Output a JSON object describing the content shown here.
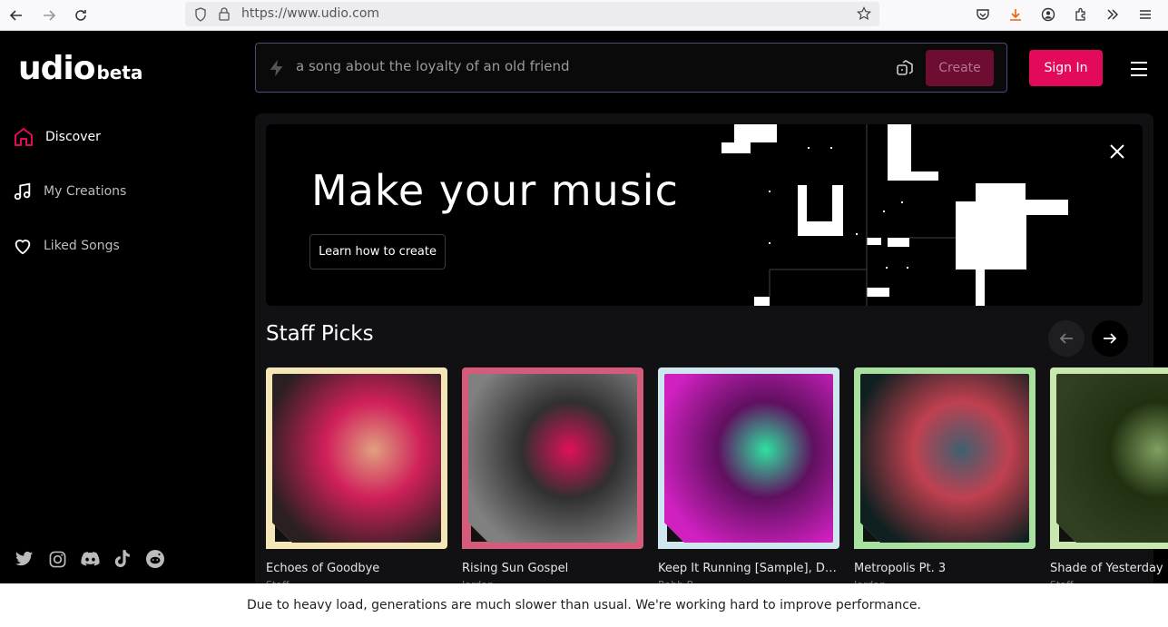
{
  "browser": {
    "url": "https://www.udio.com"
  },
  "logo": {
    "main": "udio",
    "beta": "beta"
  },
  "sidebar": {
    "items": [
      {
        "label": "Discover",
        "icon": "home-icon",
        "active": true
      },
      {
        "label": "My Creations",
        "icon": "music-note-icon",
        "active": false
      },
      {
        "label": "Liked Songs",
        "icon": "heart-icon",
        "active": false
      }
    ],
    "socials": [
      "twitter-icon",
      "instagram-icon",
      "discord-icon",
      "tiktok-icon",
      "reddit-icon"
    ]
  },
  "search": {
    "placeholder": "a song about the loyalty of an old friend",
    "create_label": "Create"
  },
  "header": {
    "signin_label": "Sign In"
  },
  "banner": {
    "title": "Make your music",
    "button_label": "Learn how to create"
  },
  "staff_picks": {
    "title": "Staff Picks",
    "cards": [
      {
        "title": "Echoes of Goodbye",
        "sub": "Staff",
        "frame": "#f5e6b8",
        "art": [
          "#2a2020",
          "#e0a080",
          "#d0205a"
        ]
      },
      {
        "title": "Rising Sun Gospel",
        "sub": "Jordan",
        "frame": "#d65a7a",
        "art": [
          "#808080",
          "#e0105a",
          "#303030"
        ]
      },
      {
        "title": "Keep It Running [Sample], Danc…",
        "sub": "Rabb B",
        "frame": "#cfe8f0",
        "art": [
          "#d020c0",
          "#30e0a0",
          "#601060"
        ]
      },
      {
        "title": "Metropolis Pt. 3",
        "sub": "Jordan",
        "frame": "#a8e0a0",
        "art": [
          "#102020",
          "#406070",
          "#c04050"
        ]
      },
      {
        "title": "Shade of Yesterday",
        "sub": "Staff",
        "frame": "#c8e8b0",
        "art": [
          "#304020",
          "#80a060",
          "#203010"
        ]
      }
    ]
  },
  "notice": {
    "text": "Due to heavy load, generations are much slower than usual. We're working hard to improve performance."
  },
  "colors": {
    "accent": "#e30a5c",
    "create_disabled": "#6e0c32"
  }
}
